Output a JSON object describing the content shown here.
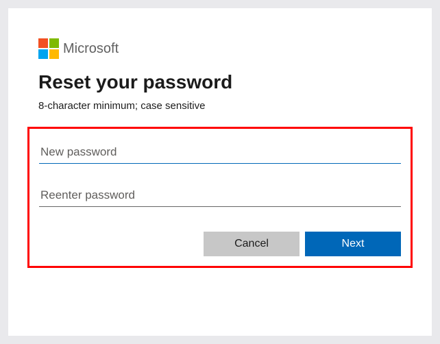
{
  "brand": {
    "name": "Microsoft"
  },
  "page": {
    "title": "Reset your password",
    "subtitle": "8-character minimum; case sensitive"
  },
  "fields": {
    "new_password": {
      "placeholder": "New password",
      "value": ""
    },
    "reenter_password": {
      "placeholder": "Reenter password",
      "value": ""
    }
  },
  "buttons": {
    "cancel": "Cancel",
    "next": "Next"
  },
  "colors": {
    "primary": "#0067b8",
    "highlight_border": "#ff0000"
  }
}
